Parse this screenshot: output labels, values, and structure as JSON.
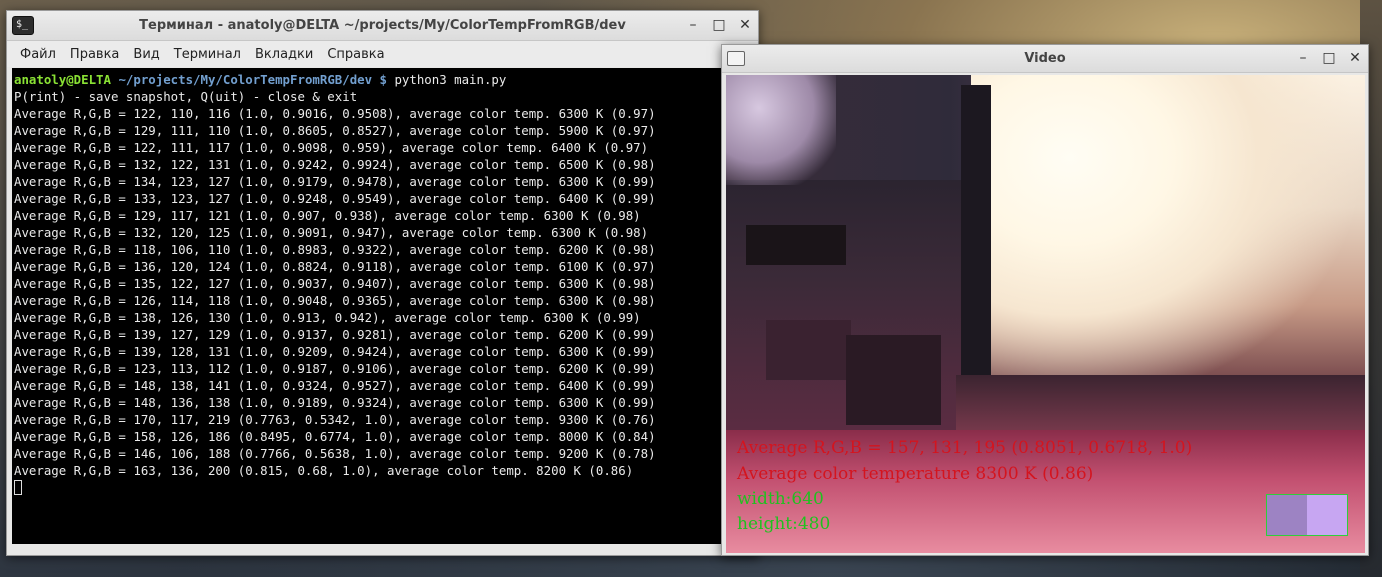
{
  "terminal": {
    "title": "Терминал - anatoly@DELTA ~/projects/My/ColorTempFromRGB/dev",
    "menu": [
      "Файл",
      "Правка",
      "Вид",
      "Терминал",
      "Вкладки",
      "Справка"
    ],
    "prompt_user": "anatoly@DELTA",
    "prompt_path": " ~/projects/My/ColorTempFromRGB/dev $",
    "command": " python3 main.py",
    "lines": [
      "P(rint) - save snapshot, Q(uit) - close & exit",
      "Average R,G,B = 122, 110, 116 (1.0, 0.9016, 0.9508), average color temp. 6300 K (0.97)",
      "Average R,G,B = 129, 111, 110 (1.0, 0.8605, 0.8527), average color temp. 5900 K (0.97)",
      "Average R,G,B = 122, 111, 117 (1.0, 0.9098, 0.959), average color temp. 6400 K (0.97)",
      "Average R,G,B = 132, 122, 131 (1.0, 0.9242, 0.9924), average color temp. 6500 K (0.98)",
      "Average R,G,B = 134, 123, 127 (1.0, 0.9179, 0.9478), average color temp. 6300 K (0.99)",
      "Average R,G,B = 133, 123, 127 (1.0, 0.9248, 0.9549), average color temp. 6400 K (0.99)",
      "Average R,G,B = 129, 117, 121 (1.0, 0.907, 0.938), average color temp. 6300 K (0.98)",
      "Average R,G,B = 132, 120, 125 (1.0, 0.9091, 0.947), average color temp. 6300 K (0.98)",
      "Average R,G,B = 118, 106, 110 (1.0, 0.8983, 0.9322), average color temp. 6200 K (0.98)",
      "Average R,G,B = 136, 120, 124 (1.0, 0.8824, 0.9118), average color temp. 6100 K (0.97)",
      "Average R,G,B = 135, 122, 127 (1.0, 0.9037, 0.9407), average color temp. 6300 K (0.98)",
      "Average R,G,B = 126, 114, 118 (1.0, 0.9048, 0.9365), average color temp. 6300 K (0.98)",
      "Average R,G,B = 138, 126, 130 (1.0, 0.913, 0.942), average color temp. 6300 K (0.99)",
      "Average R,G,B = 139, 127, 129 (1.0, 0.9137, 0.9281), average color temp. 6200 K (0.99)",
      "Average R,G,B = 139, 128, 131 (1.0, 0.9209, 0.9424), average color temp. 6300 K (0.99)",
      "Average R,G,B = 123, 113, 112 (1.0, 0.9187, 0.9106), average color temp. 6200 K (0.99)",
      "Average R,G,B = 148, 138, 141 (1.0, 0.9324, 0.9527), average color temp. 6400 K (0.99)",
      "Average R,G,B = 148, 136, 138 (1.0, 0.9189, 0.9324), average color temp. 6300 K (0.99)",
      "Average R,G,B = 170, 117, 219 (0.7763, 0.5342, 1.0), average color temp. 9300 K (0.76)",
      "Average R,G,B = 158, 126, 186 (0.8495, 0.6774, 1.0), average color temp. 8000 K (0.84)",
      "Average R,G,B = 146, 106, 188 (0.7766, 0.5638, 1.0), average color temp. 9200 K (0.78)",
      "Average R,G,B = 163, 136, 200 (0.815, 0.68, 1.0), average color temp. 8200 K (0.86)"
    ]
  },
  "video": {
    "title": "Video",
    "overlay_avg": "Average R,G,B = 157, 131, 195 (0.8051, 0.6718, 1.0)",
    "overlay_temp": "Average color temperature 8300 K (0.86)",
    "overlay_width": "width:640",
    "overlay_height": "height:480",
    "swatch_colors": [
      "#9d83c3",
      "#c7a6f2"
    ]
  },
  "colors": {
    "terminal_bg": "#000000",
    "prompt_user": "#8ae234",
    "prompt_path": "#729fcf",
    "overlay_red": "#d4141e",
    "overlay_green": "#1fc21f"
  }
}
